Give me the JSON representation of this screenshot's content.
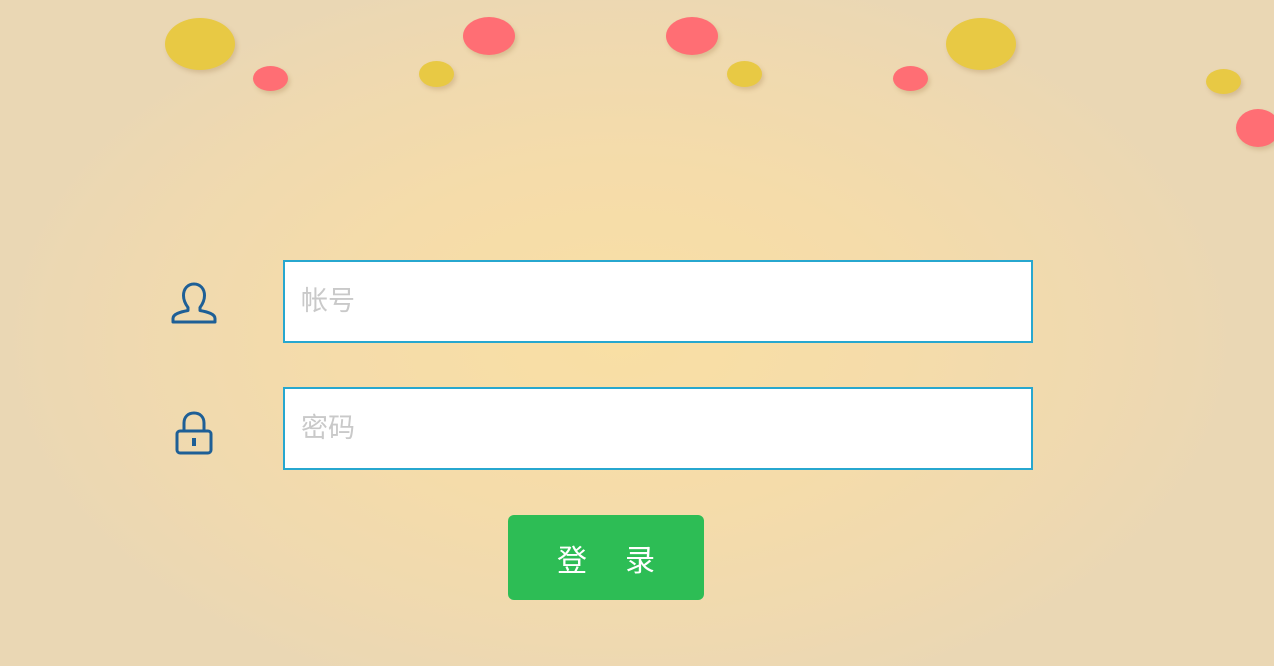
{
  "colors": {
    "accent_border": "#27a7cf",
    "icon": "#1e5f96",
    "button": "#2dbd55",
    "dot_yellow": "#e8c944",
    "dot_red": "#ff6e74"
  },
  "form": {
    "username": {
      "icon": "user-icon",
      "value": "",
      "placeholder": "帐号"
    },
    "password": {
      "icon": "lock-icon",
      "value": "",
      "placeholder": "密码"
    },
    "submit_label": "登录"
  }
}
